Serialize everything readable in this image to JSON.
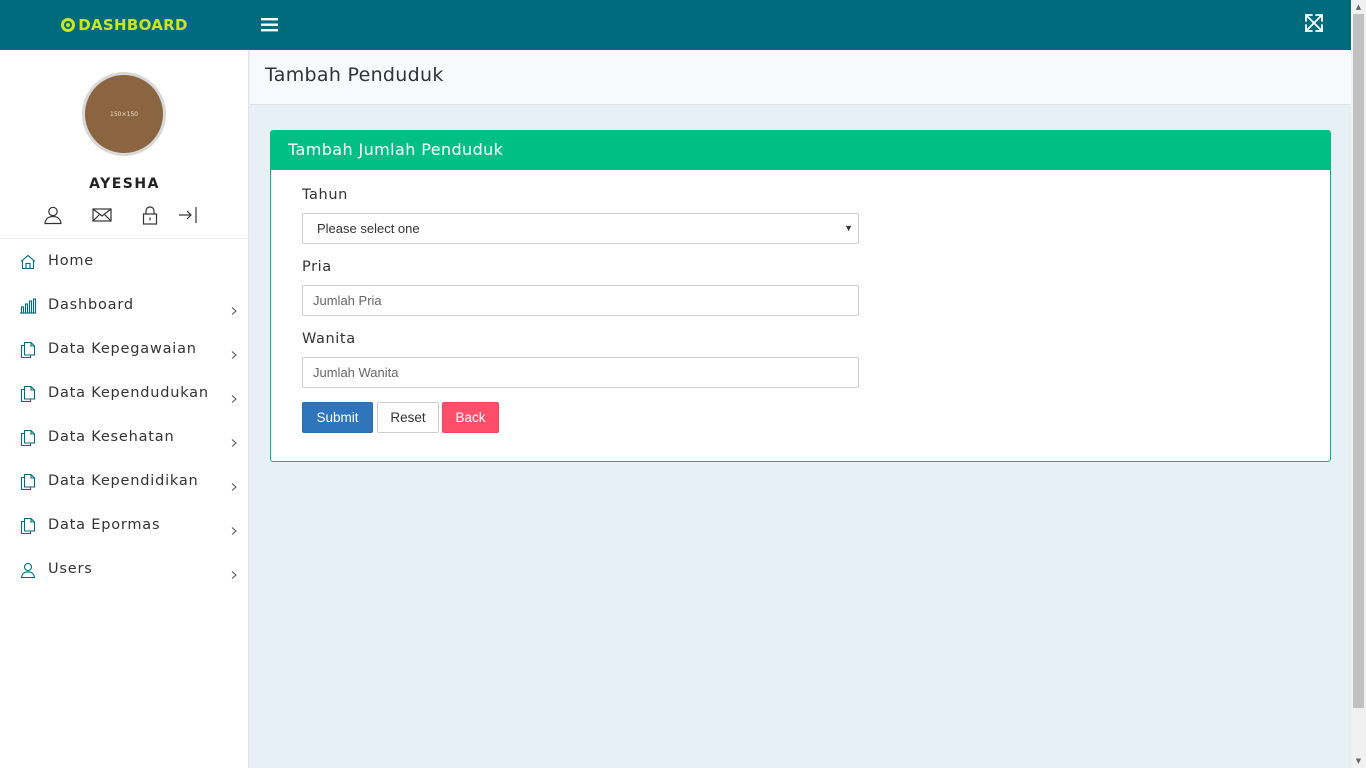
{
  "brand": {
    "text": "DASHBOARD",
    "accent": "#c8e61e",
    "bar_color": "#006b7d"
  },
  "topbar": {
    "menu_icon": "hamburger-icon",
    "fullscreen_icon": "expand-icon"
  },
  "profile": {
    "avatar_text": "150×150",
    "name": "AYESHA",
    "icons": [
      "user-icon",
      "envelope-icon",
      "lock-icon",
      "logout-icon"
    ]
  },
  "sidebar": {
    "items": [
      {
        "label": "Home",
        "icon": "home-icon",
        "has_children": false
      },
      {
        "label": "Dashboard",
        "icon": "bar-chart-icon",
        "has_children": true
      },
      {
        "label": "Data Kepegawaian",
        "icon": "document-icon",
        "has_children": true
      },
      {
        "label": "Data Kependudukan",
        "icon": "document-icon",
        "has_children": true
      },
      {
        "label": "Data Kesehatan",
        "icon": "document-icon",
        "has_children": true
      },
      {
        "label": "Data Kependidikan",
        "icon": "document-icon",
        "has_children": true
      },
      {
        "label": "Data Epormas",
        "icon": "document-icon",
        "has_children": true
      },
      {
        "label": "Users",
        "icon": "user-icon",
        "has_children": true
      }
    ]
  },
  "page": {
    "title": "Tambah Penduduk"
  },
  "card": {
    "title": "Tambah Jumlah Penduduk",
    "header_color": "#00bf85",
    "fields": {
      "tahun": {
        "label": "Tahun",
        "selected": "Please select one"
      },
      "pria": {
        "label": "Pria",
        "placeholder": "Jumlah Pria",
        "value": ""
      },
      "wanita": {
        "label": "Wanita",
        "placeholder": "Jumlah Wanita",
        "value": ""
      }
    },
    "buttons": {
      "submit": "Submit",
      "reset": "Reset",
      "back": "Back"
    }
  },
  "colors": {
    "submit": "#2f75bb",
    "back": "#ff4e6a",
    "content_bg": "#e8f0f7"
  }
}
